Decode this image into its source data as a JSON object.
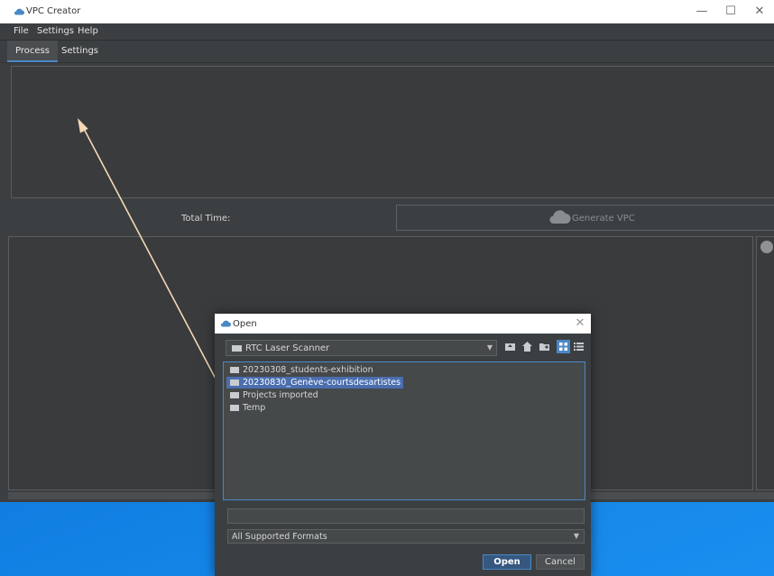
{
  "window": {
    "title": "VPC Creator",
    "controls": {
      "minimize": "—",
      "maximize": "☐",
      "close": "✕"
    }
  },
  "menu": [
    "File",
    "Settings",
    "Help"
  ],
  "tabs": [
    {
      "label": "Process",
      "active": true
    },
    {
      "label": "Settings",
      "active": false
    }
  ],
  "process": {
    "total_time_label": "Total Time:",
    "generate_label": "Generate VPC"
  },
  "dialog": {
    "title": "Open",
    "close": "✕",
    "location": "RTC Laser Scanner",
    "toolbar_icons": [
      "up-folder-icon",
      "home-icon",
      "new-folder-icon",
      "list-view-icon",
      "details-view-icon"
    ],
    "files": [
      {
        "name": "20230308_students-exhibition",
        "selected": false
      },
      {
        "name": "20230830_Genève-courtsdesartistes",
        "selected": true
      },
      {
        "name": "Projects imported",
        "selected": false
      },
      {
        "name": "Temp",
        "selected": false
      }
    ],
    "file_name_value": "",
    "filter": "All Supported Formats",
    "open_label": "Open",
    "cancel_label": "Cancel"
  },
  "colors": {
    "accent": "#4a88c7",
    "selection": "#4b6eaf",
    "panel": "#3c3f41",
    "annotation_arrow": "#f2d8b4"
  }
}
